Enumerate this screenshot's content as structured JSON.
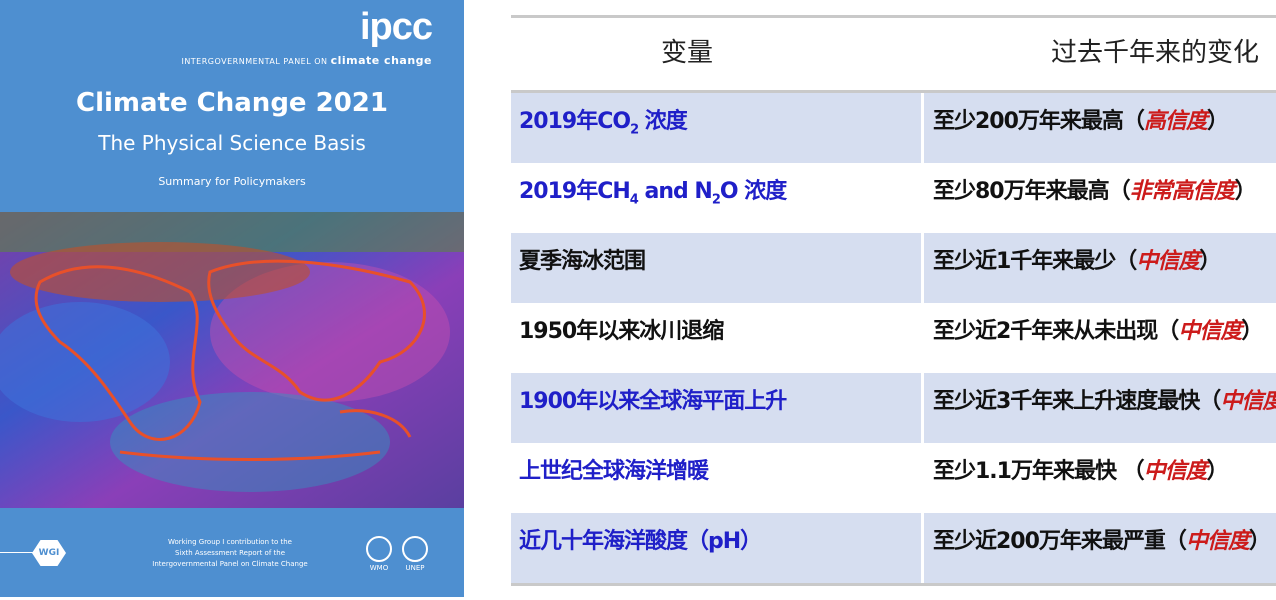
{
  "cover": {
    "logo": "ipcc",
    "org_line_1": "INTERGOVERNMENTAL PANEL ON ",
    "org_line_2": "climate change",
    "title": "Climate Change 2021",
    "subtitle": "The Physical Science Basis",
    "spm": "Summary for Policymakers",
    "wg_badge": "WGI",
    "contribution_1": "Working Group I contribution to the",
    "contribution_2": "Sixth Assessment Report of the",
    "contribution_3": "Intergovernmental Panel on Climate Change",
    "wmo_caption": "WMO",
    "unep_caption": "UNEP",
    "colors": {
      "background": "#4e8fd0"
    }
  },
  "table": {
    "header_variable": "变量",
    "header_change": "过去千年来的变化",
    "colors": {
      "highlight_text": "#1f1fc8",
      "confidence": "#cc1b1b",
      "shaded_row": "#d6def0"
    },
    "rows": [
      {
        "var_pre": "2019年CO",
        "var_sub": "2",
        "var_post": " 浓度",
        "change": "至少200万年来最高（",
        "confidence": "高信度",
        "close": "）",
        "var_color": "blue"
      },
      {
        "var_pre": "2019年CH",
        "var_sub": "4",
        "var_post": " and N",
        "var_sub2": "2",
        "var_post2": "O 浓度",
        "change": "至少80万年来最高（",
        "confidence": "非常高信度",
        "close": "）",
        "var_color": "blue"
      },
      {
        "var_pre": "夏季海冰范围",
        "change": "至少近1千年来最少（",
        "confidence": "中信度",
        "close": "）",
        "var_color": "black"
      },
      {
        "var_pre": "1950年以来冰川退缩",
        "change": "至少近2千年来从未出现（",
        "confidence": "中信度",
        "close": "）",
        "var_color": "black"
      },
      {
        "var_pre": "1900年以来全球海平面上升",
        "change": "至少近3千年来上升速度最快（",
        "confidence": "中信度",
        "close": "）",
        "var_color": "blue"
      },
      {
        "var_pre": "上世纪全球海洋增暖",
        "change": "至少1.1万年来最快 （",
        "confidence": "中信度",
        "close": "）",
        "var_color": "blue"
      },
      {
        "var_pre": "近几十年海洋酸度（pH）",
        "change": "至少近200万年来最严重（",
        "confidence": "中信度",
        "close": "）",
        "var_color": "blue"
      }
    ]
  }
}
